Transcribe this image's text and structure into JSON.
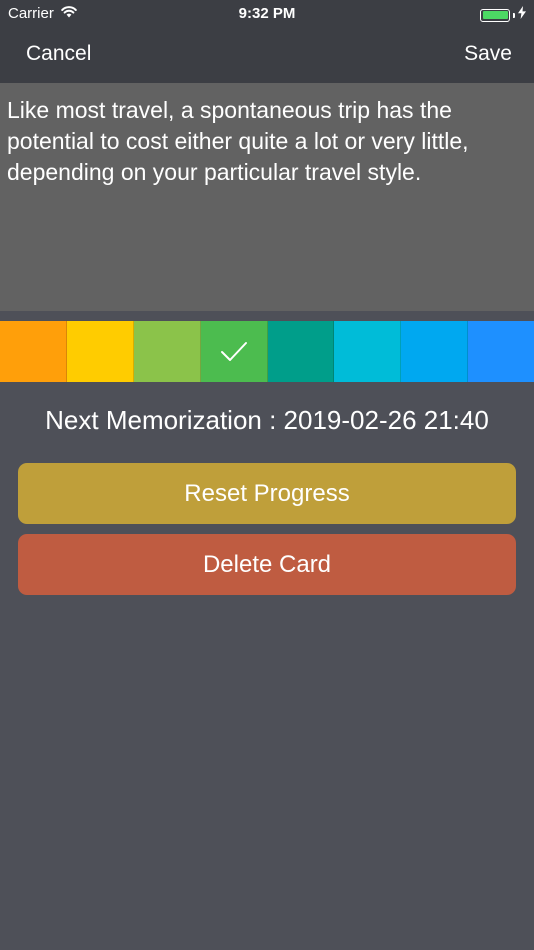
{
  "status_bar": {
    "carrier": "Carrier",
    "time": "9:32 PM",
    "battery_level": 1.0,
    "icons": [
      "wifi-icon",
      "battery-icon",
      "charging-bolt-icon"
    ]
  },
  "nav": {
    "cancel_label": "Cancel",
    "save_label": "Save"
  },
  "card": {
    "text": "Like most travel, a spontaneous trip has the potential to cost either quite a lot or very little, depending on your particular travel style."
  },
  "colors": {
    "swatches": [
      "#ff9f0a",
      "#ffcc00",
      "#8bc34a",
      "#4cbc4f",
      "#009e8a",
      "#00bcd8",
      "#00a8f0",
      "#1e90ff"
    ],
    "selected_index": 3,
    "background": "#4e5058",
    "nav_background": "#3c3e44",
    "text_area_background": "#626262",
    "reset_button": "#bf9f3a",
    "delete_button": "#bf5c41"
  },
  "memorization": {
    "text": "Next Memorization : 2019-02-26 21:40"
  },
  "actions": {
    "reset_label": "Reset Progress",
    "delete_label": "Delete Card"
  }
}
